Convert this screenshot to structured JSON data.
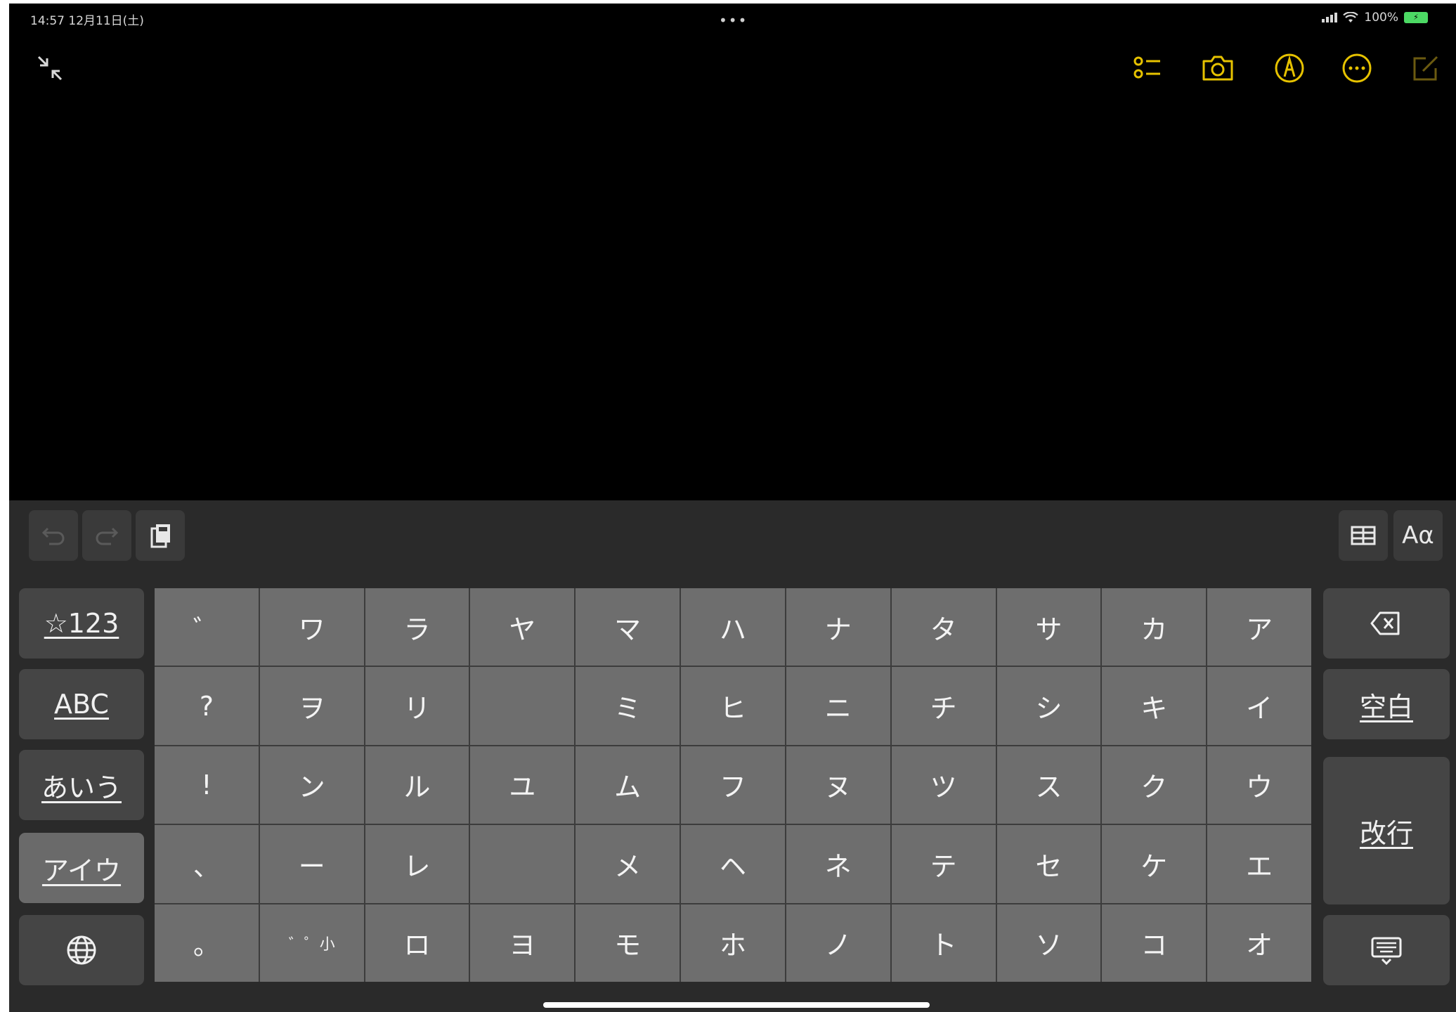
{
  "status_bar": {
    "time_date": "14:57 12月11日(土)",
    "battery": "100%",
    "multitask_dots": "•••"
  },
  "toolbar": {
    "icons": [
      "collapse-icon",
      "checklist-icon",
      "camera-icon",
      "markup-pen-icon",
      "more-icon",
      "compose-icon"
    ],
    "accent_color": "#e6c200"
  },
  "assistant_bar": {
    "format_label": "Aα"
  },
  "keyboard": {
    "side_keys": [
      "☆123",
      "ABC",
      "あいう",
      "アイウ"
    ],
    "active_side_key": "アイウ",
    "kana_rows": [
      [
        "゛",
        "ワ",
        "ラ",
        "ヤ",
        "マ",
        "ハ",
        "ナ",
        "タ",
        "サ",
        "カ",
        "ア"
      ],
      [
        "?",
        "ヲ",
        "リ",
        "",
        "ミ",
        "ヒ",
        "ニ",
        "チ",
        "シ",
        "キ",
        "イ"
      ],
      [
        "!",
        "ン",
        "ル",
        "ユ",
        "ム",
        "フ",
        "ヌ",
        "ツ",
        "ス",
        "ク",
        "ウ"
      ],
      [
        "、",
        "ー",
        "レ",
        "",
        "メ",
        "ヘ",
        "ネ",
        "テ",
        "セ",
        "ケ",
        "エ"
      ],
      [
        "。",
        "゛゜小",
        "ロ",
        "ヨ",
        "モ",
        "ホ",
        "ノ",
        "ト",
        "ソ",
        "コ",
        "オ"
      ]
    ],
    "space_label": "空白",
    "return_label": "改行"
  }
}
